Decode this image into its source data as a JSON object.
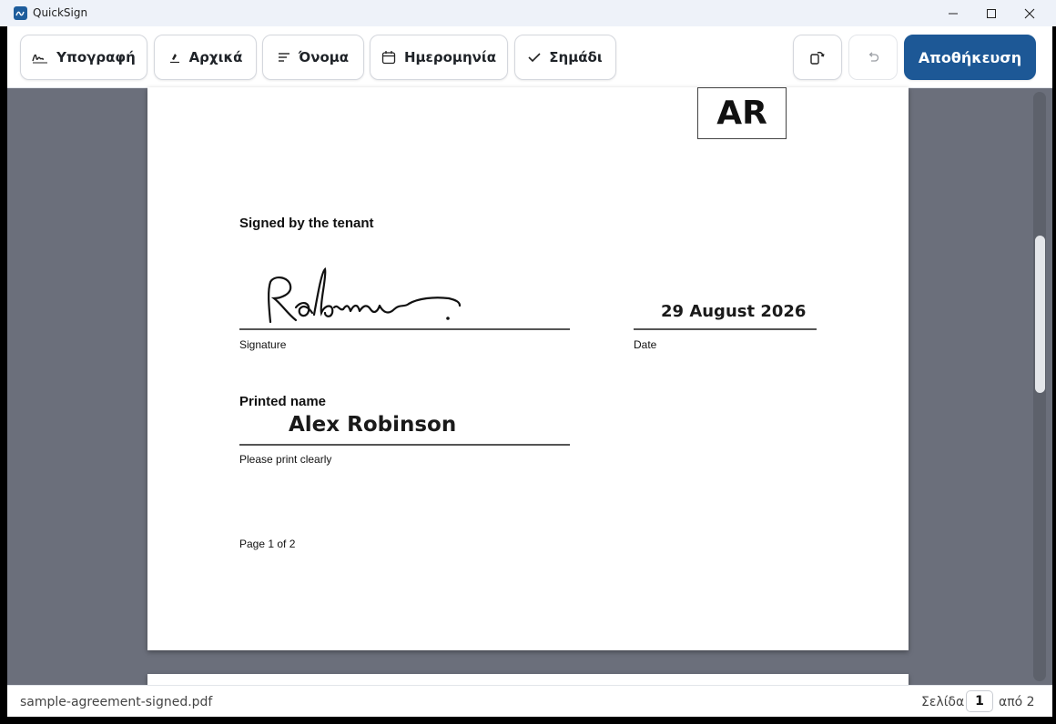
{
  "window": {
    "title": "QuickSign"
  },
  "colors": {
    "accent": "#1d5896",
    "canvas": "#6b6f7b"
  },
  "toolbar": {
    "signature_label": "Υπογραφή",
    "initials_label": "Αρχικά",
    "name_label": "Όνομα",
    "date_label": "Ημερομηνία",
    "checkmark_label": "Σημάδι",
    "save_label": "Αποθήκευση",
    "icons": {
      "signature": "signature-icon",
      "initials": "initials-pen-icon",
      "name": "text-lines-icon",
      "date": "calendar-icon",
      "checkmark": "checkmark-icon",
      "rotate": "rotate-page-icon",
      "undo": "undo-icon"
    }
  },
  "document": {
    "initials_stamp": "AR",
    "signed_heading": "Signed by the tenant",
    "signature_image_text": "Robinson",
    "signature_caption": "Signature",
    "date_value": "29 August 2026",
    "date_caption": "Date",
    "printed_name_heading": "Printed name",
    "printed_name_value": "Alex Robinson",
    "printed_name_caption": "Please print clearly",
    "page_footer": "Page 1 of 2"
  },
  "status": {
    "filename": "sample-agreement-signed.pdf",
    "page_label": "Σελίδα",
    "current_page": "1",
    "total_label": "από 2"
  }
}
